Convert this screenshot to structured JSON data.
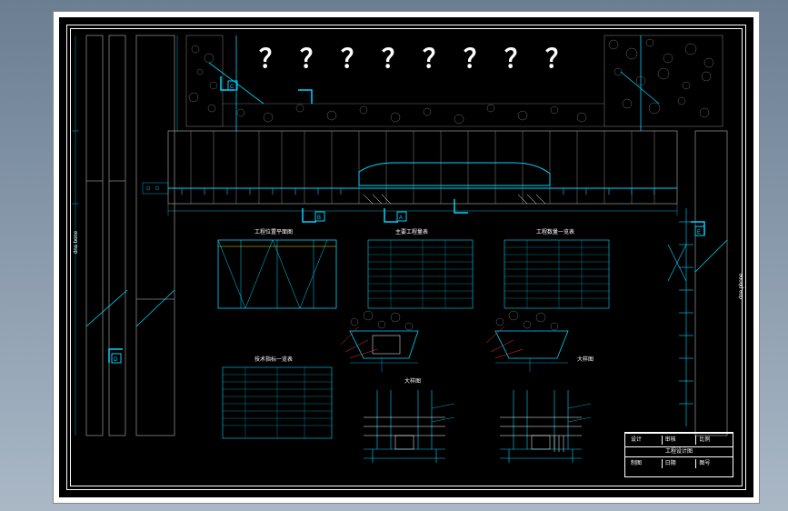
{
  "drawing": {
    "title_cn": "？？？？？？？？",
    "question_marks": [
      "？",
      "？",
      "？",
      "？",
      "？",
      "？",
      "？",
      "？"
    ],
    "section_labels": [
      "A",
      "B",
      "C",
      "D",
      "E"
    ],
    "subtitle_1": "工程位置平面图",
    "subtitle_2": "主要工程量表",
    "subtitle_3": "工程数量一览表",
    "subtitle_4": "技术指标一览表",
    "subtitle_5": "大样图",
    "subtitle_6": "大样图",
    "side_label_left": "dna bone",
    "side_label_right": "dna phone",
    "titleblock": {
      "row1": [
        "设计",
        "审核",
        "比例"
      ],
      "row2": [
        "制图",
        "日期",
        "图号"
      ],
      "project": "工程设计图"
    }
  }
}
